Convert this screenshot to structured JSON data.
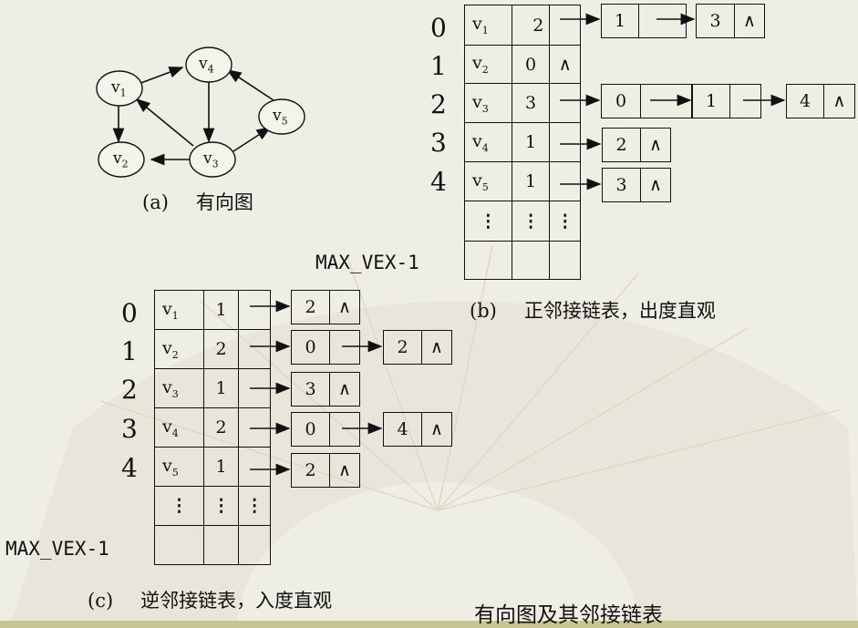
{
  "graph": {
    "vertices": [
      {
        "name": "v",
        "sub": "1"
      },
      {
        "name": "v",
        "sub": "2"
      },
      {
        "name": "v",
        "sub": "3"
      },
      {
        "name": "v",
        "sub": "4"
      },
      {
        "name": "v",
        "sub": "5"
      }
    ],
    "caption_label": "(a)",
    "caption_text": "有向图"
  },
  "panel_b": {
    "indices": [
      "0",
      "1",
      "2",
      "3",
      "4"
    ],
    "rows": [
      {
        "v": "v",
        "sub": "1",
        "count": "2",
        "end": ""
      },
      {
        "v": "v",
        "sub": "2",
        "count": "0",
        "end": "∧"
      },
      {
        "v": "v",
        "sub": "3",
        "count": "3",
        "end": ""
      },
      {
        "v": "v",
        "sub": "4",
        "count": "1",
        "end": ""
      },
      {
        "v": "v",
        "sub": "5",
        "count": "1",
        "end": ""
      }
    ],
    "lists": [
      [
        "1",
        "3"
      ],
      [],
      [
        "0",
        "1",
        "4"
      ],
      [
        "2"
      ],
      [
        "3"
      ]
    ],
    "null_symbol": "∧",
    "max_label": "MAX_VEX-1",
    "caption_label": "(b)",
    "caption_text": "正邻接链表，出度直观"
  },
  "panel_c": {
    "indices": [
      "0",
      "1",
      "2",
      "3",
      "4"
    ],
    "rows": [
      {
        "v": "v",
        "sub": "1",
        "count": "1"
      },
      {
        "v": "v",
        "sub": "2",
        "count": "2"
      },
      {
        "v": "v",
        "sub": "3",
        "count": "1"
      },
      {
        "v": "v",
        "sub": "4",
        "count": "2"
      },
      {
        "v": "v",
        "sub": "5",
        "count": "1"
      }
    ],
    "lists": [
      [
        "2"
      ],
      [
        "0",
        "2"
      ],
      [
        "3"
      ],
      [
        "0",
        "4"
      ],
      [
        "2"
      ]
    ],
    "null_symbol": "∧",
    "max_label": "MAX_VEX-1",
    "caption_label": "(c)",
    "caption_text": "逆邻接链表，入度直观"
  },
  "dots": "⋮",
  "main_caption": "有向图及其邻接链表"
}
